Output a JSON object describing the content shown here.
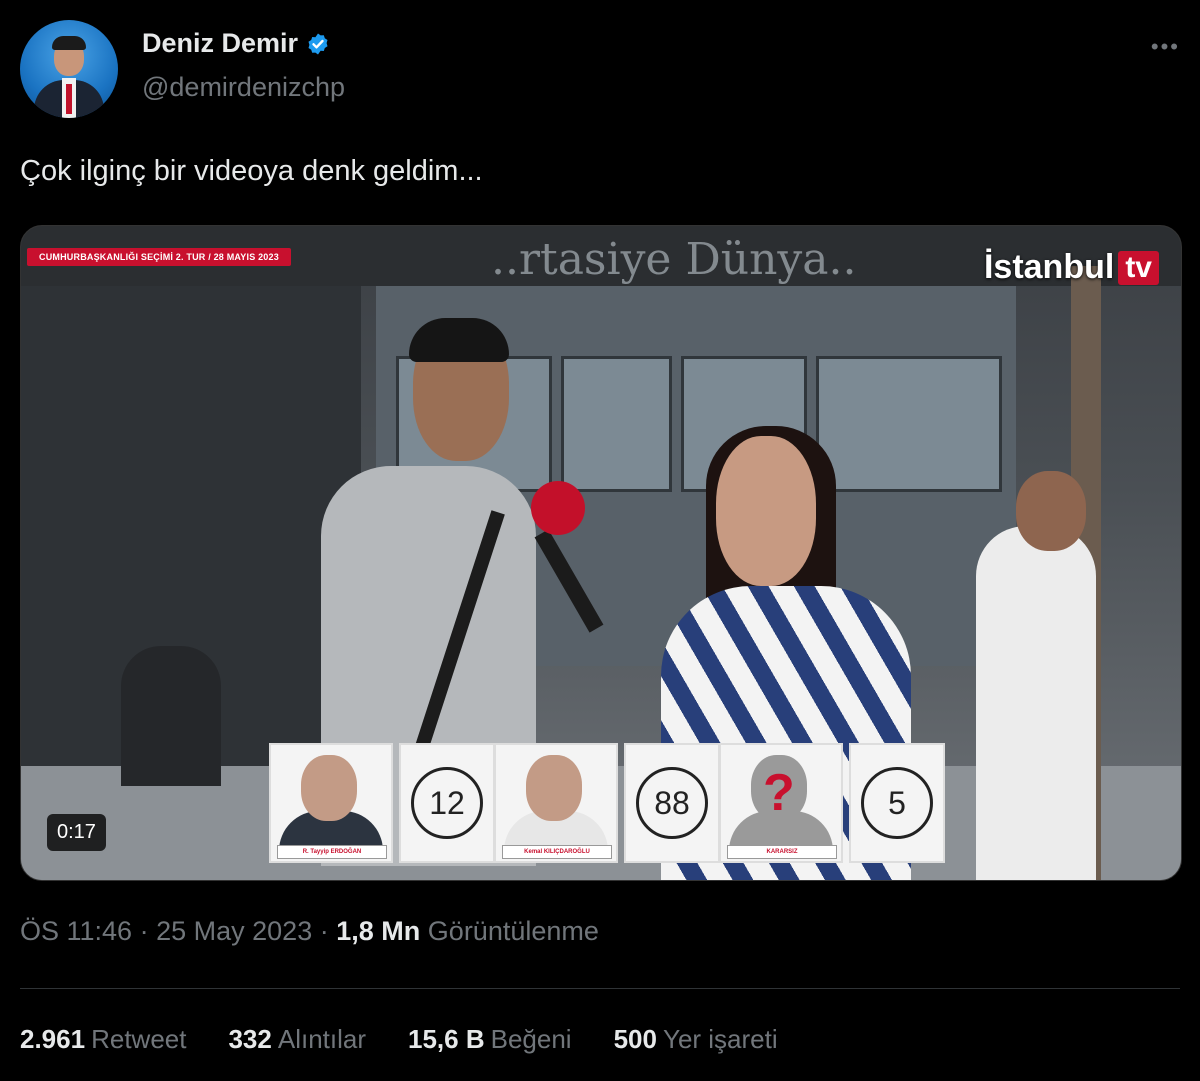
{
  "author": {
    "name": "Deniz Demir",
    "handle": "@demirdenizchp",
    "verified": true
  },
  "more_icon": "more-horizontal-icon",
  "tweet": {
    "text": "Çok ilginç bir videoya denk geldim..."
  },
  "video": {
    "banner": "CUMHURBAŞKANLIĞI SEÇİMİ 2. TUR / 28 MAYIS 2023",
    "store_sign": "..rtasiye Dünya..",
    "channel_logo_word": "İstanbul",
    "channel_logo_tv": "tv",
    "duration": "0:17",
    "poll": [
      {
        "name": "R. Tayyip ERDOĞAN",
        "score": "12"
      },
      {
        "name": "Kemal KILIÇDAROĞLU",
        "score": "88"
      },
      {
        "name": "KARARSIZ",
        "score": "5",
        "unknown_mark": "?"
      }
    ]
  },
  "meta": {
    "time": "ÖS 11:46",
    "sep1": "·",
    "date": "25 May 2023",
    "sep2": "·",
    "views_value": "1,8 Mn",
    "views_label": "Görüntülenme"
  },
  "stats": {
    "retweets_value": "2.961",
    "retweets_label": "Retweet",
    "quotes_value": "332",
    "quotes_label": "Alıntılar",
    "likes_value": "15,6 B",
    "likes_label": "Beğeni",
    "bookmarks_value": "500",
    "bookmarks_label": "Yer işareti"
  },
  "colors": {
    "background": "#000000",
    "text": "#e7e9ea",
    "secondary": "#71767b",
    "verified": "#1d9bf0",
    "channel_red": "#c8102e"
  }
}
